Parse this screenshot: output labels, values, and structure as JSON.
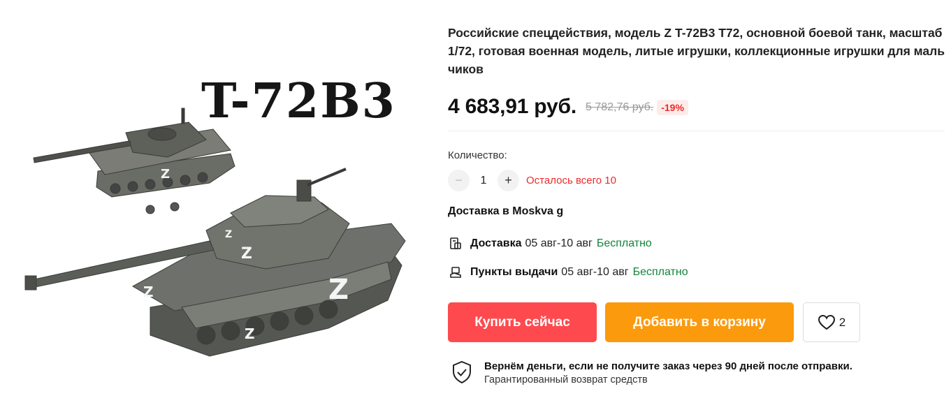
{
  "gallery": {
    "image_caption": "T-72B3"
  },
  "product": {
    "title": "Российские спецдействия, модель Z T-72B3 T72, основной боевой танк, масштаб 1/72, готовая военная модель, литые игрушки, коллекционные игрушки для мальчиков",
    "price": "4 683,91 руб.",
    "old_price": "5 782,76 руб.",
    "discount": "-19%"
  },
  "quantity": {
    "label": "Количество:",
    "minus": "−",
    "value": "1",
    "plus": "+",
    "stock_note": "Осталось всего 10"
  },
  "shipping": {
    "title": "Доставка в Moskva g",
    "courier": {
      "icon": "delivery-box-icon",
      "name": "Доставка",
      "date": "05 авг-10 авг",
      "price": "Бесплатно"
    },
    "pickup": {
      "icon": "pickup-point-icon",
      "name": "Пункты выдачи",
      "date": "05 авг-10 авг",
      "price": "Бесплатно"
    }
  },
  "actions": {
    "buy_now": "Купить сейчас",
    "add_to_cart": "Добавить в корзину",
    "wishlist_count": "2"
  },
  "guarantee": {
    "icon": "shield-check-icon",
    "title": "Вернём деньги, если не получите заказ через 90 дней после отправки.",
    "subtitle": "Гарантированный возврат средств"
  },
  "colors": {
    "buy": "#fe4a4e",
    "cart": "#fb9a0d",
    "stock": "#ee2a2a",
    "free": "#11843a"
  }
}
